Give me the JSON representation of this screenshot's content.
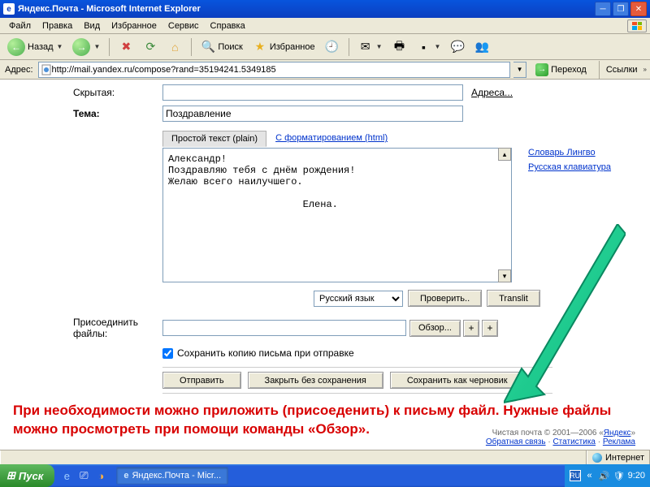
{
  "titlebar": {
    "title": "Яндекс.Почта - Microsoft Internet Explorer"
  },
  "menubar": {
    "items": [
      "Файл",
      "Правка",
      "Вид",
      "Избранное",
      "Сервис",
      "Справка"
    ]
  },
  "toolbar": {
    "back": "Назад",
    "search": "Поиск",
    "favorites": "Избранное"
  },
  "addrbar": {
    "label": "Адрес:",
    "url": "http://mail.yandex.ru/compose?rand=35194241.5349185",
    "go": "Переход",
    "links": "Ссылки"
  },
  "form": {
    "hidden_label": "Скрытая:",
    "subject_label": "Тема:",
    "subject_value": "Поздравление",
    "addresses": "Адреса...",
    "tab_plain": "Простой текст (plain)",
    "tab_html": "С форматированием (html)",
    "body": "Александр!\nПоздравляю тебя с днём рождения!\nЖелаю всего наилучшего.\n\n                       Елена.",
    "lingvo": "Словарь Лингво",
    "keyboard": "Русская клавиатура",
    "lang": "Русский язык",
    "check": "Проверить..",
    "translit": "Translit",
    "attach_label": "Присоединить файлы:",
    "browse": "Обзор...",
    "plus": "+",
    "plus2": "+",
    "save_copy": "Сохранить копию письма при отправке",
    "send": "Отправить",
    "close": "Закрыть без сохранения",
    "draft": "Сохранить как черновик"
  },
  "instruction": "При необходимости можно приложить (присоеденить) к письму файл. Нужные файлы можно просмотреть при помощи команды «Обзор».",
  "footer": {
    "copyright": "Чистая почта © 2001—2006 «",
    "yandex": "Яндекс",
    "closeq": "»",
    "feedback": "Обратная связь",
    "stats": "Статистика",
    "ads": "Реклама"
  },
  "statusbar": {
    "internet": "Интернет"
  },
  "taskbar": {
    "start": "Пуск",
    "task1": "Яндекс.Почта - Micr...",
    "lang": "RU",
    "time": "9:20"
  }
}
